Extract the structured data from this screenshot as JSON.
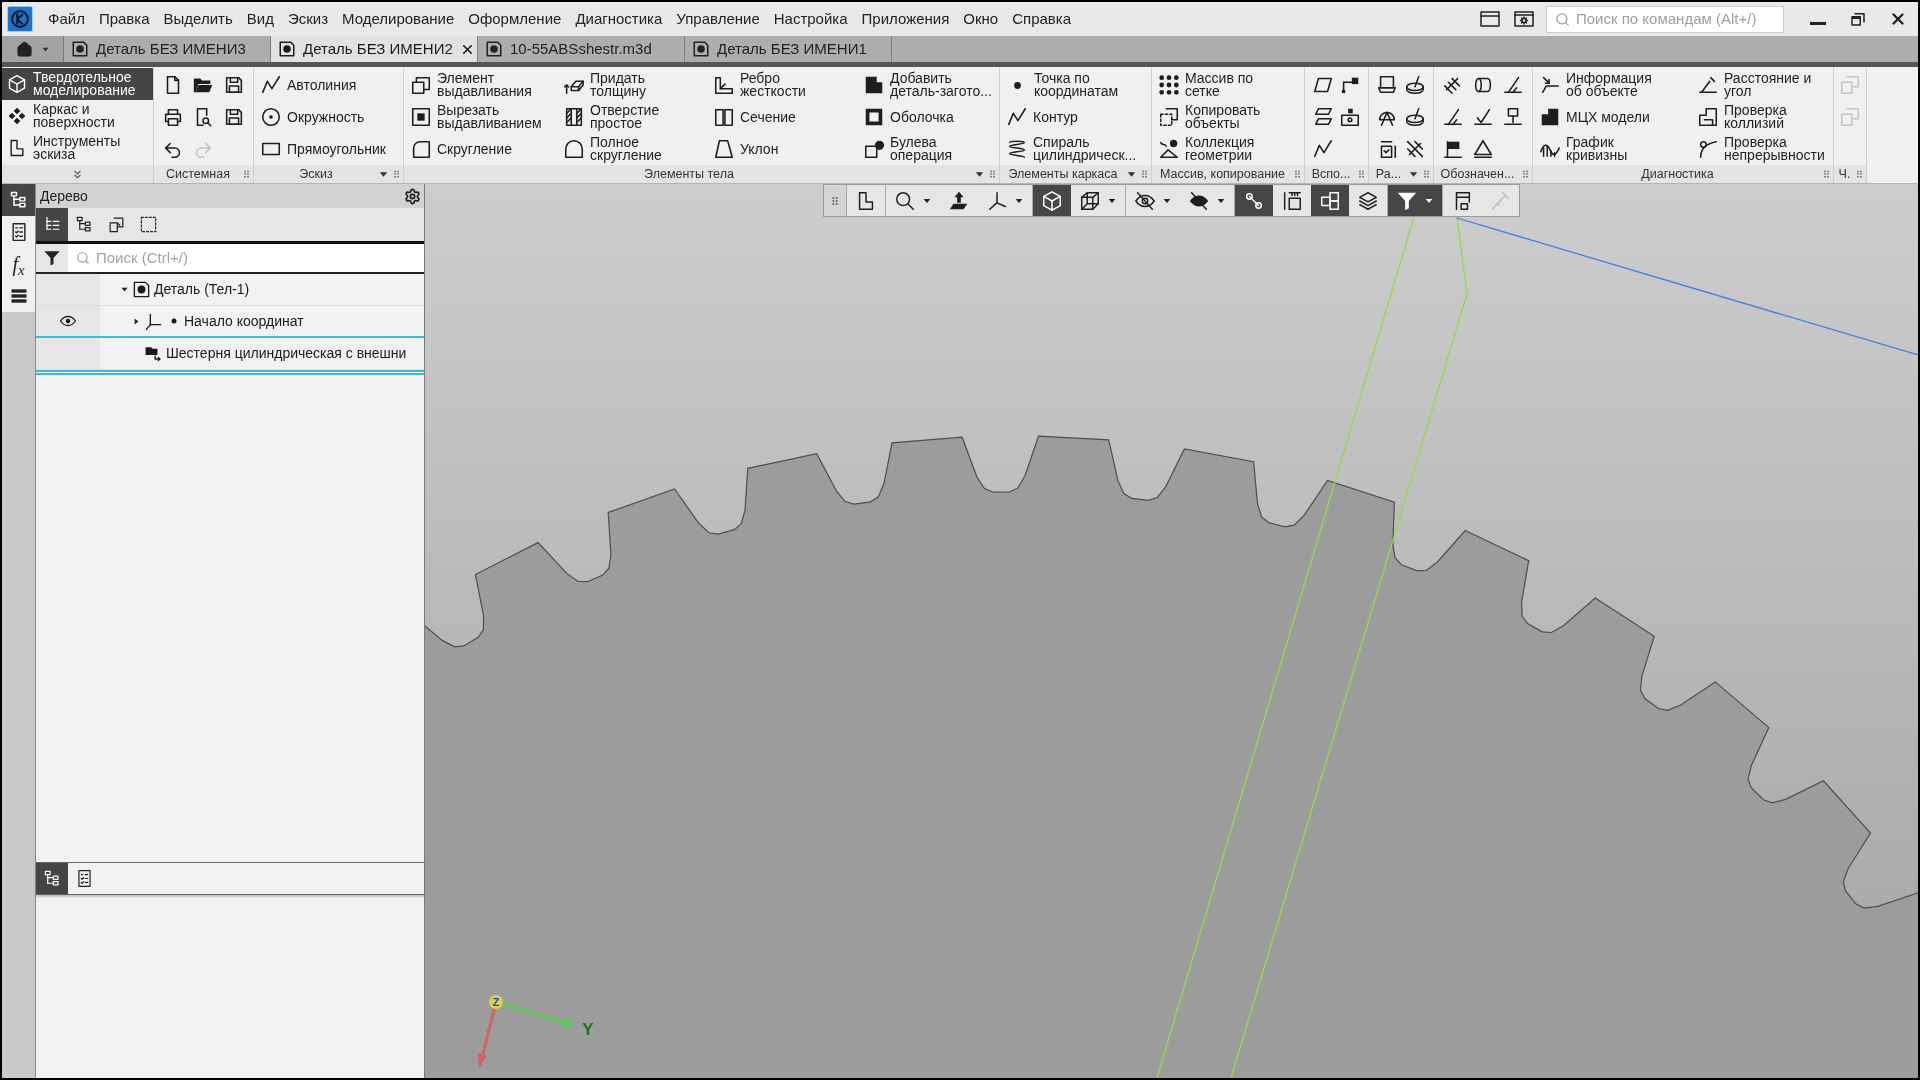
{
  "menu": [
    "Файл",
    "Правка",
    "Выделить",
    "Вид",
    "Эскиз",
    "Моделирование",
    "Оформление",
    "Диагностика",
    "Управление",
    "Настройка",
    "Приложения",
    "Окно",
    "Справка"
  ],
  "command_search": {
    "placeholder": "Поиск по командам (Alt+/)"
  },
  "tabs": [
    {
      "label": "Деталь БЕЗ ИМЕНИ3",
      "selected": false
    },
    {
      "label": "Деталь БЕЗ ИМЕНИ2",
      "selected": true
    },
    {
      "label": "10-55ABSshestr.m3d",
      "selected": false
    },
    {
      "label": "Деталь БЕЗ ИМЕНИ1",
      "selected": false
    }
  ],
  "ribbon": {
    "modes": [
      {
        "label": "Твердотельное моделирование",
        "selected": true
      },
      {
        "label": "Каркас и поверхности",
        "selected": false
      },
      {
        "label": "Инструменты эскиза",
        "selected": false
      }
    ],
    "groups": [
      {
        "kind": "grid",
        "label": "Системная",
        "menu": false,
        "tools": [
          {
            "disabled": false
          },
          {
            "disabled": false
          },
          {
            "disabled": false
          },
          {
            "disabled": false
          },
          {
            "disabled": false
          },
          {
            "disabled": false
          },
          {
            "disabled": false
          },
          {
            "disabled": true
          }
        ]
      },
      {
        "kind": "list",
        "label": "Эскиз",
        "menu": true,
        "tools": [
          {
            "label": "Автолиния"
          },
          {
            "label": "Окружность"
          },
          {
            "label": "Прямоугольник"
          }
        ]
      },
      {
        "kind": "list",
        "label": "Элементы тела",
        "menu": true,
        "tools": [
          {
            "label": "Элемент выдавливания"
          },
          {
            "label": "Вырезать выдавливанием"
          },
          {
            "label": "Скругление"
          },
          {
            "label": "Придать толщину"
          },
          {
            "label": "Отверстие простое"
          },
          {
            "label": "Полное скругление"
          },
          {
            "label": "Ребро жесткости"
          },
          {
            "label": "Сечение"
          },
          {
            "label": "Уклон"
          },
          {
            "label": "Добавить деталь-загото..."
          },
          {
            "label": "Оболочка"
          },
          {
            "label": "Булева операция"
          }
        ]
      },
      {
        "kind": "list",
        "label": "Элементы каркаса",
        "menu": true,
        "tools": [
          {
            "label": "Точка по координатам"
          },
          {
            "label": "Контур"
          },
          {
            "label": "Спираль цилиндрическ..."
          }
        ]
      },
      {
        "kind": "list",
        "label": "Массив, копирование",
        "menu": false,
        "tools": [
          {
            "label": "Массив по сетке"
          },
          {
            "label": "Копировать объекты"
          },
          {
            "label": "Коллекция геометрии"
          }
        ]
      },
      {
        "kind": "grid",
        "label": "Вспо...",
        "menu": false,
        "tools": [
          {
            "disabled": false
          },
          {
            "disabled": false
          },
          {
            "disabled": false
          },
          {
            "disabled": false
          },
          {
            "disabled": false
          }
        ]
      },
      {
        "kind": "grid",
        "label": "Ра...",
        "menu": true,
        "tools": [
          {
            "disabled": false
          },
          {
            "disabled": false
          },
          {
            "disabled": false
          },
          {
            "disabled": false
          },
          {
            "disabled": false
          },
          {
            "disabled": false
          }
        ]
      },
      {
        "kind": "grid",
        "label": "Обозначен...",
        "menu": false,
        "tools": [
          {
            "disabled": false
          },
          {
            "disabled": false
          },
          {
            "disabled": false
          },
          {
            "disabled": false
          },
          {
            "disabled": false
          },
          {
            "disabled": false
          },
          {
            "disabled": false
          },
          {
            "disabled": false
          }
        ]
      },
      {
        "kind": "list",
        "label": "Диагностика",
        "menu": false,
        "tools": [
          {
            "label": "Информация об объекте"
          },
          {
            "label": "МЦХ модели"
          },
          {
            "label": "График кривизны"
          },
          {
            "label": "Расстояние и угол"
          },
          {
            "label": "Проверка коллизий"
          },
          {
            "label": "Проверка непрерывности"
          }
        ]
      },
      {
        "kind": "grid",
        "label": "Ч.",
        "menu": false,
        "tools": [
          {
            "disabled": true
          },
          {
            "disabled": true
          }
        ]
      }
    ]
  },
  "side_strip": [
    {
      "kind": "icon",
      "selected": true
    },
    {
      "kind": "icon",
      "selected": false
    },
    {
      "kind": "text",
      "label": "f$_{x}$",
      "selected": false
    },
    {
      "kind": "icon",
      "selected": false
    }
  ],
  "tree_panel": {
    "title": "Дерево",
    "views": [
      {
        "selected": true
      },
      {
        "selected": false
      },
      {
        "selected": false
      },
      {
        "selected": false
      }
    ],
    "search": {
      "placeholder": "Поиск (Ctrl+/)"
    },
    "tree": [
      {
        "kind": "part",
        "label": "Деталь (Тел-1)",
        "expanded": true,
        "visible": false,
        "children": [
          {
            "kind": "origin",
            "label": "Начало координат",
            "expanded": false,
            "visible": true
          },
          {
            "kind": "feature",
            "label": "Шестерня цилиндрическая с внешни",
            "visible": false
          }
        ]
      }
    ],
    "bottom_tabs": [
      {
        "selected": true
      },
      {
        "selected": false
      }
    ]
  },
  "view_toolbar": [
    {
      "on": false,
      "disabled": false
    },
    {
      "on": false,
      "disabled": false
    },
    {
      "on": false,
      "disabled": false
    },
    {
      "on": false,
      "disabled": false
    },
    {
      "on": true,
      "disabled": false
    },
    {
      "on": false,
      "disabled": false
    },
    {
      "on": false,
      "disabled": false
    },
    {
      "on": false,
      "disabled": false
    },
    {
      "on": true,
      "disabled": false
    },
    {
      "on": false,
      "disabled": false
    },
    {
      "on": true,
      "disabled": false
    },
    {
      "on": false,
      "disabled": false
    },
    {
      "on": true,
      "disabled": false
    },
    {
      "on": false,
      "disabled": false
    },
    {
      "on": false,
      "disabled": true
    }
  ],
  "viewport": {
    "axis_labels": [
      "Z",
      "Y"
    ]
  }
}
